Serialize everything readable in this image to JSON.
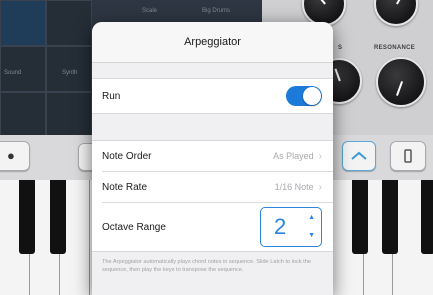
{
  "popover": {
    "title": "Arpeggiator",
    "run": {
      "label": "Run",
      "on": true
    },
    "note_order": {
      "label": "Note Order",
      "value": "As Played"
    },
    "note_rate": {
      "label": "Note Rate",
      "value": "1/16 Note"
    },
    "octave_range": {
      "label": "Octave Range",
      "value": "2"
    },
    "footer": "The Arpeggiator automatically plays chord notes in sequence. Slide Latch to lock the sequence, then play the keys to transpose the sequence."
  },
  "background": {
    "knob_labels": [
      "S",
      "RESONANCE"
    ],
    "pad_labels": [
      "Sound",
      "Synth"
    ],
    "top_labels": [
      "Scale",
      "Big Drums"
    ]
  },
  "colors": {
    "accent": "#1c7ad9",
    "stepper": "#2c84dc"
  },
  "icons": {
    "chevron": "chevron-right-icon",
    "stepper_up": "triangle-up-icon",
    "stepper_down": "triangle-down-icon"
  }
}
